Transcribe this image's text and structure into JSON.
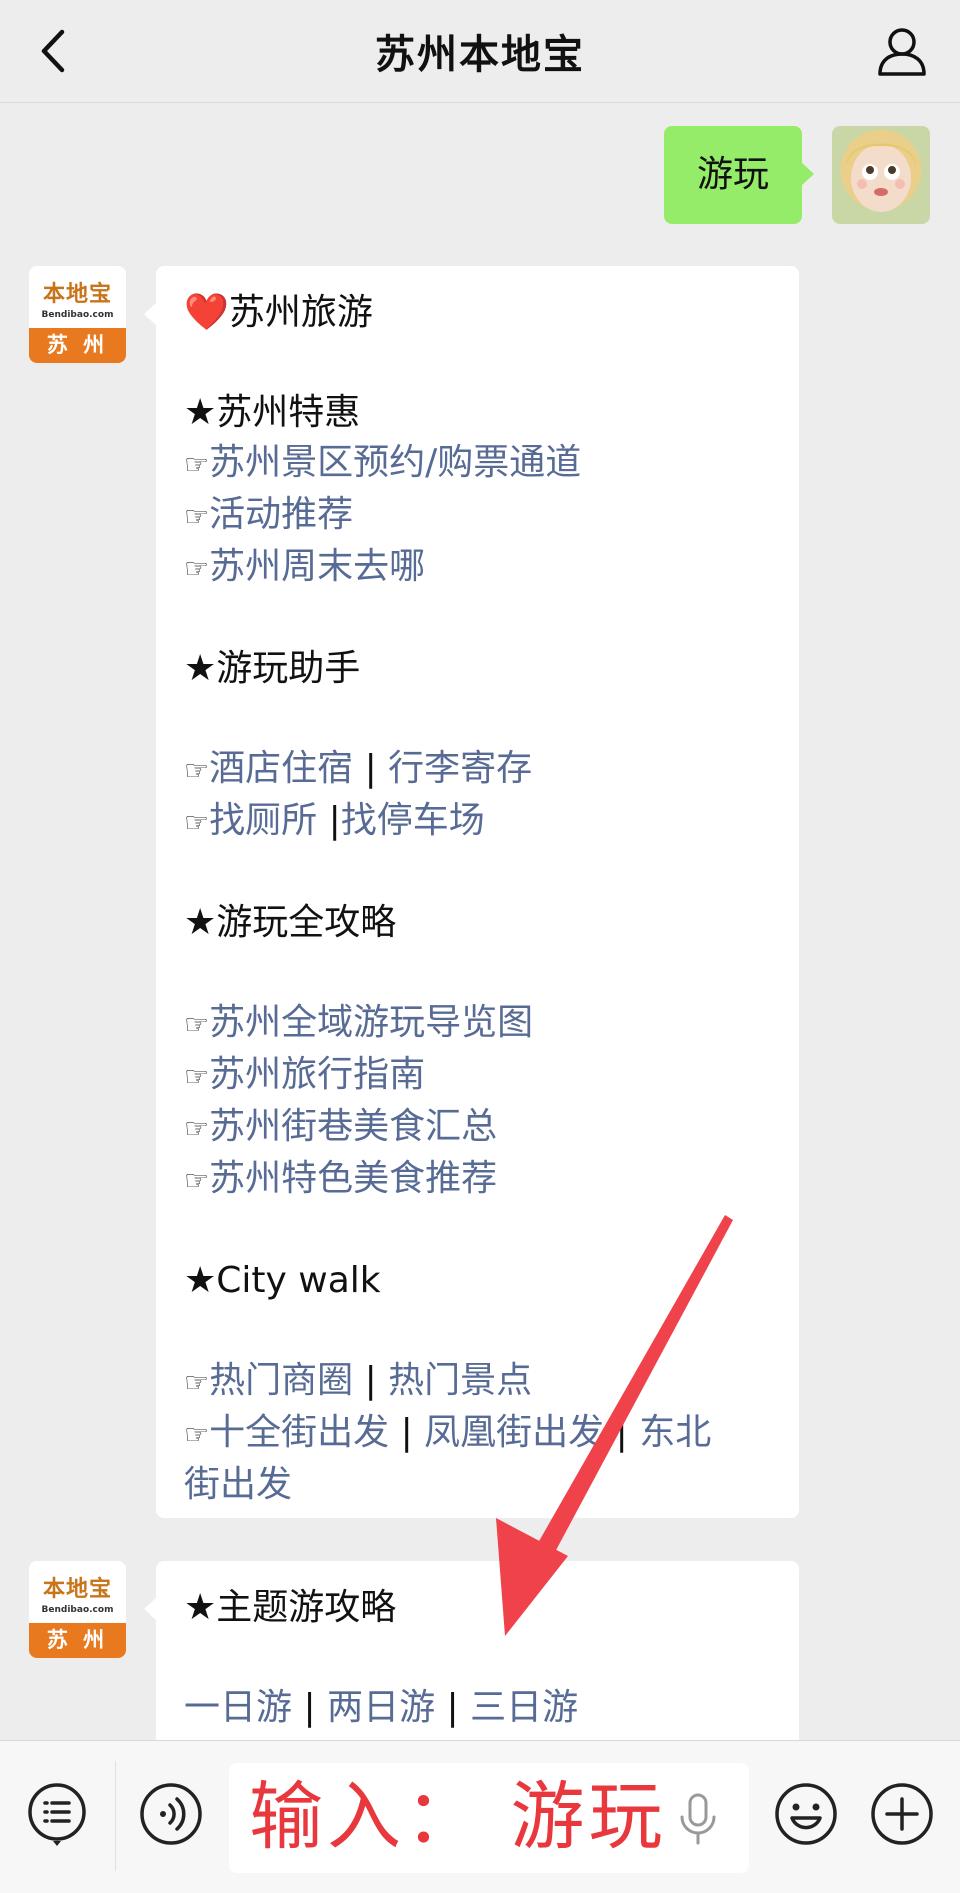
{
  "header": {
    "title": "苏州本地宝",
    "back_icon": "chevron-left-icon",
    "profile_icon": "person-icon"
  },
  "sent": {
    "text": "游玩"
  },
  "bot": {
    "logo_cn": "本地宝",
    "logo_en": "Bendibao.com",
    "logo_city": "苏 州"
  },
  "message1": {
    "heart": "❤️",
    "heading": "苏州旅游",
    "sections": {
      "offers_title": "★苏州特惠",
      "offers": [
        "苏州景区预约/购票通道",
        "活动推荐",
        "苏州周末去哪"
      ],
      "helper_title": "★游玩助手",
      "helper_row1": [
        "酒店住宿",
        "行李寄存"
      ],
      "helper_row2": [
        "找厕所",
        "找停车场"
      ],
      "guide_title": "★游玩全攻略",
      "guides": [
        "苏州全域游玩导览图",
        "苏州旅行指南",
        "苏州街巷美食汇总",
        "苏州特色美食推荐"
      ],
      "citywalk_title": "★City walk",
      "citywalk_row1": [
        "热门商圈",
        "热门景点"
      ],
      "citywalk_row2": [
        "十全街出发",
        "凤凰街出发",
        "东北"
      ],
      "citywalk_row3": "街出发"
    },
    "hand": "☞",
    "pipe": "|"
  },
  "message2": {
    "title": "★主题游攻略",
    "trips": [
      "一日游",
      "两日游",
      "三日游"
    ]
  },
  "input": {
    "text": "输入：  游玩"
  },
  "colors": {
    "link": "#576b95",
    "sent_bubble": "#95ec69",
    "brand_orange": "#e8791f",
    "arrow": "#f0424a"
  }
}
